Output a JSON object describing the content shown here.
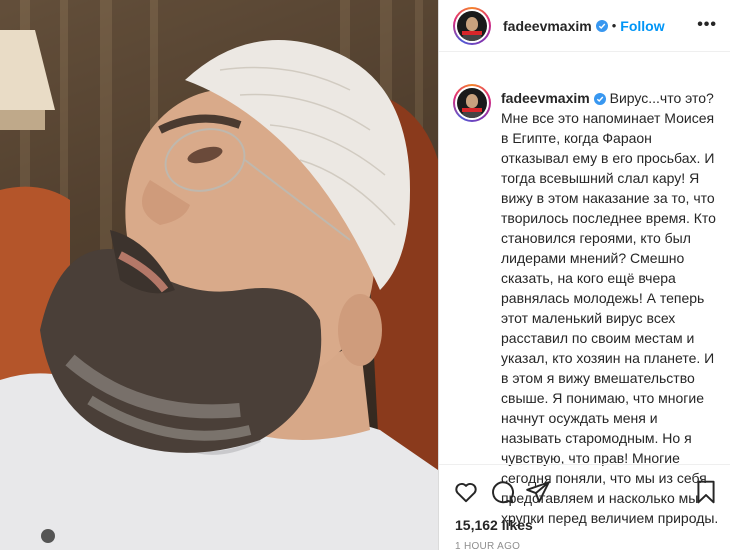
{
  "post": {
    "image_alt": "Bearded man wearing a white knitted cap and rimless glasses",
    "header": {
      "username": "fadeevmaxim",
      "separator": "•",
      "follow_label": "Follow",
      "more_label": "•••"
    },
    "caption": {
      "username": "fadeevmaxim",
      "text": "Вирус...что это? Мне все это напоминает Моисея в Египте, когда Фараон отказывал ему в его просьбах. И тогда всевышний слал кару! Я вижу в этом наказание за то, что творилось последнее время. Кто становился героями, кто был лидерами мнений? Смешно сказать, на кого ещё вчера равнялась молодежь! А теперь этот маленький вирус всех расставил по своим местам и указал, кто хозяин на планете. И в этом я вижу вмешательство свыше. Я понимаю, что многие начнут осуждать меня и называть старомодным. Но я чувствую, что прав! Многие сегодня поняли, что мы из себя представляем и насколько мы хрупки перед величием природы."
    },
    "likes": "15,162 likes",
    "time": "1 HOUR AGO",
    "icons": {
      "like": "heart-icon",
      "comment": "comment-icon",
      "share": "share-icon",
      "save": "bookmark-icon",
      "verified": "verified-badge-icon"
    },
    "colors": {
      "accent": "#0095f6",
      "verified": "#3897f0",
      "text": "#262626",
      "muted": "#8e8e8e"
    }
  }
}
